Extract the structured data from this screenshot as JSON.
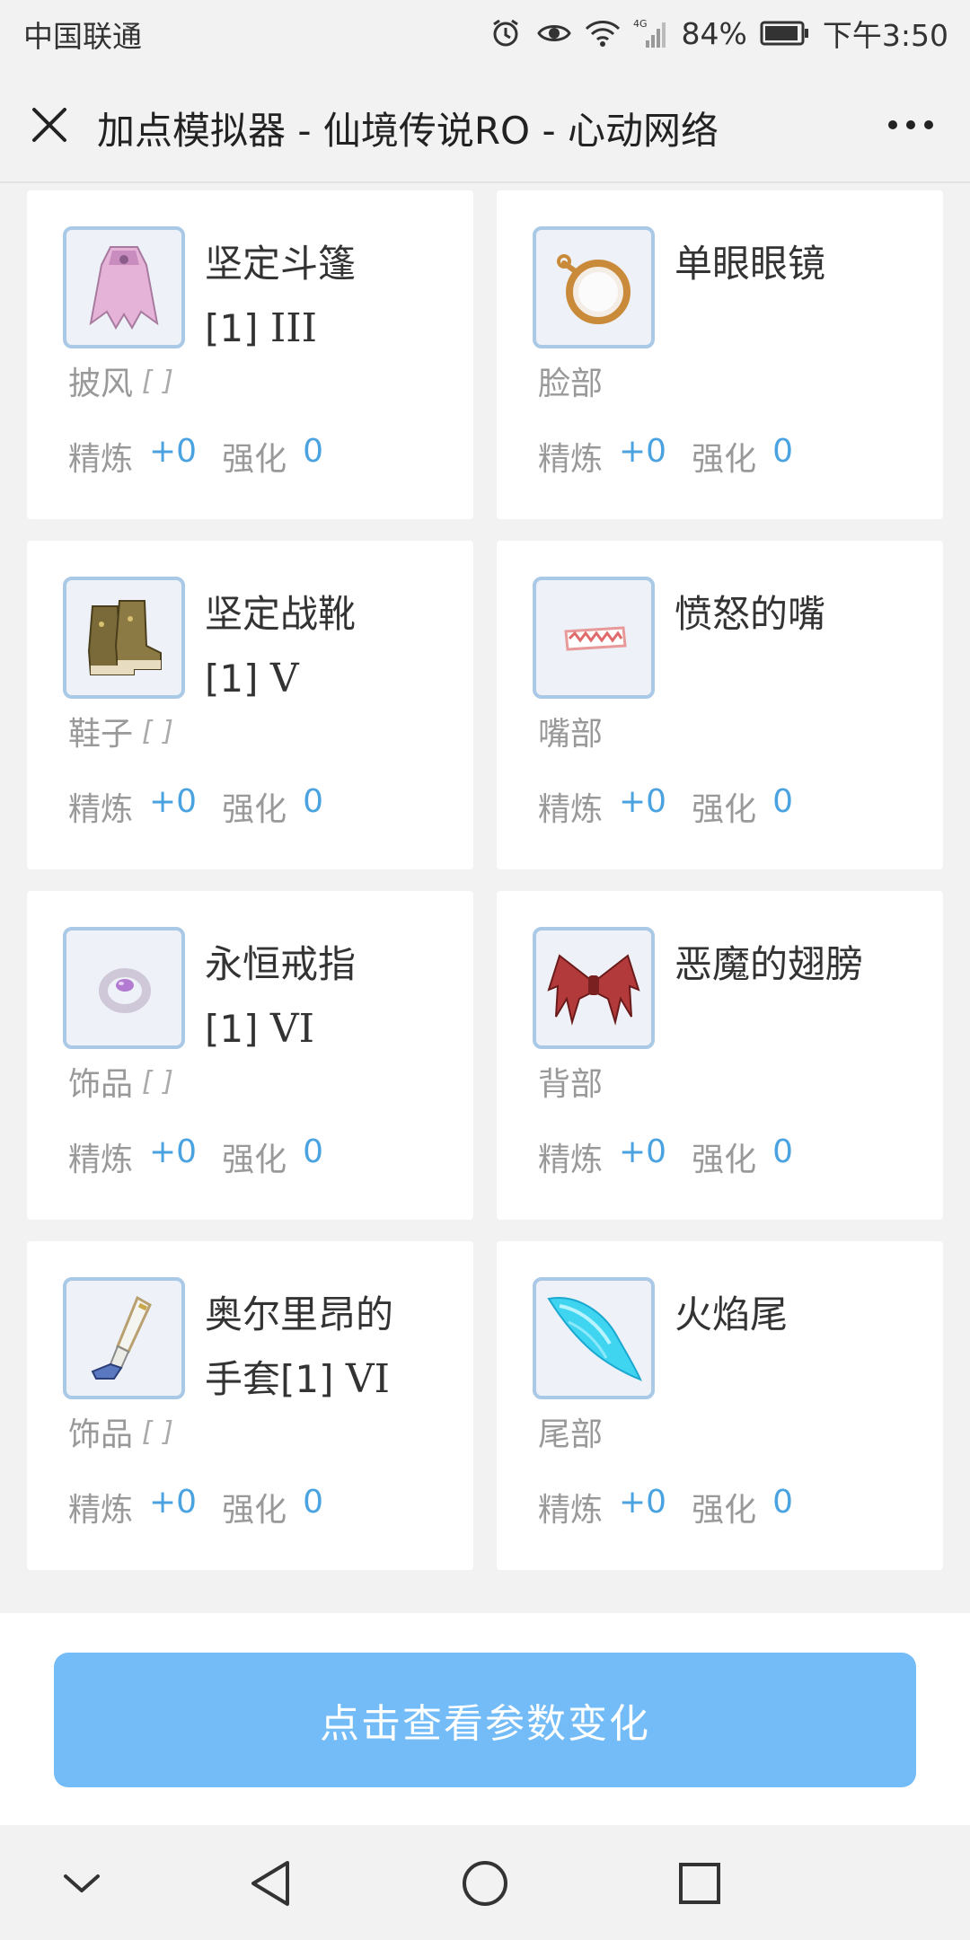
{
  "status_bar": {
    "carrier": "中国联通",
    "battery": "84%",
    "time": "下午3:50",
    "network": "4G"
  },
  "header": {
    "title": "加点模拟器 - 仙境传说RO - 心动网络"
  },
  "labels": {
    "refine": "精炼",
    "enhance": "强化",
    "slot_mark": "[ ]"
  },
  "items": [
    {
      "name": "坚定斗篷",
      "name_line2": "[1]",
      "roman": "III",
      "slot": "披风",
      "has_slot_mark": true,
      "refine": "+0",
      "enhance": "0",
      "icon": "cloak-icon"
    },
    {
      "name": "单眼眼镜",
      "name_line2": "",
      "roman": "",
      "slot": "脸部",
      "has_slot_mark": false,
      "refine": "+0",
      "enhance": "0",
      "icon": "monocle-icon"
    },
    {
      "name": "坚定战靴",
      "name_line2": "[1]",
      "roman": "V",
      "slot": "鞋子",
      "has_slot_mark": true,
      "refine": "+0",
      "enhance": "0",
      "icon": "boots-icon"
    },
    {
      "name": "愤怒的嘴",
      "name_line2": "",
      "roman": "",
      "slot": "嘴部",
      "has_slot_mark": false,
      "refine": "+0",
      "enhance": "0",
      "icon": "mouth-icon"
    },
    {
      "name": "永恒戒指",
      "name_line2": "[1]",
      "roman": "VI",
      "slot": "饰品",
      "has_slot_mark": true,
      "refine": "+0",
      "enhance": "0",
      "icon": "ring-icon"
    },
    {
      "name": "恶魔的翅膀",
      "name_line2": "",
      "roman": "",
      "slot": "背部",
      "has_slot_mark": false,
      "refine": "+0",
      "enhance": "0",
      "icon": "wings-icon"
    },
    {
      "name": "奥尔里昂的",
      "name_line2": "手套[1]",
      "roman": "VI",
      "slot": "饰品",
      "has_slot_mark": true,
      "refine": "+0",
      "enhance": "0",
      "icon": "glove-icon"
    },
    {
      "name": "火焰尾",
      "name_line2": "",
      "roman": "",
      "slot": "尾部",
      "has_slot_mark": false,
      "refine": "+0",
      "enhance": "0",
      "icon": "tail-icon"
    }
  ],
  "action": {
    "label": "点击查看参数变化"
  },
  "colors": {
    "accent": "#4aa3e0",
    "button": "#74bcf7",
    "icon_border": "#a9c9e6"
  }
}
